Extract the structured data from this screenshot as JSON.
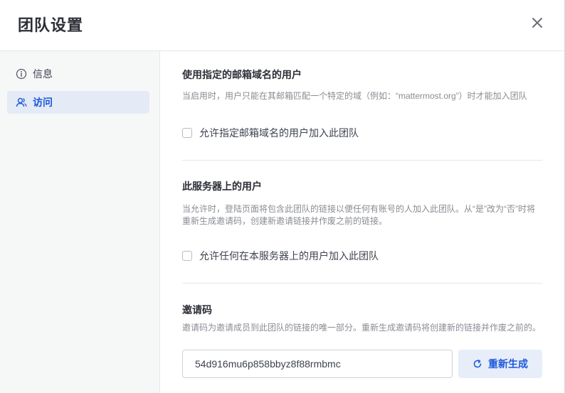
{
  "modal": {
    "title": "团队设置"
  },
  "sidebar": {
    "items": [
      {
        "label": "信息",
        "icon": "info-icon"
      },
      {
        "label": "访问",
        "icon": "users-icon"
      }
    ]
  },
  "sections": {
    "email_domain": {
      "title": "使用指定的邮箱域名的用户",
      "description": "当启用时，用户只能在其邮箱匹配一个特定的域（例如：“mattermost.org”）时才能加入团队",
      "checkbox_label": "允许指定邮箱域名的用户加入此团队",
      "checked": false
    },
    "server_users": {
      "title": "此服务器上的用户",
      "description_line1": "当允许时，登陆页面将包含此团队的链接以便任何有账号的人加入此团队。从“是”改为“否”时将",
      "description_line2": "重新生成邀请码，创建新邀请链接并作废之前的链接。",
      "checkbox_label": "允许任何在本服务器上的用户加入此团队",
      "checked": false
    },
    "invite_code": {
      "title": "邀请码",
      "description": "邀请码为邀请成员到此团队的链接的唯一部分。重新生成邀请码将创建新的链接并作废之前的。",
      "value": "54d916mu6p858bbyz8f88rmbmc",
      "regenerate_label": "重新生成"
    }
  },
  "colors": {
    "accent": "#1c58d9",
    "active_bg": "#e4ebf6",
    "sidebar_bg": "#f6f7f7"
  }
}
